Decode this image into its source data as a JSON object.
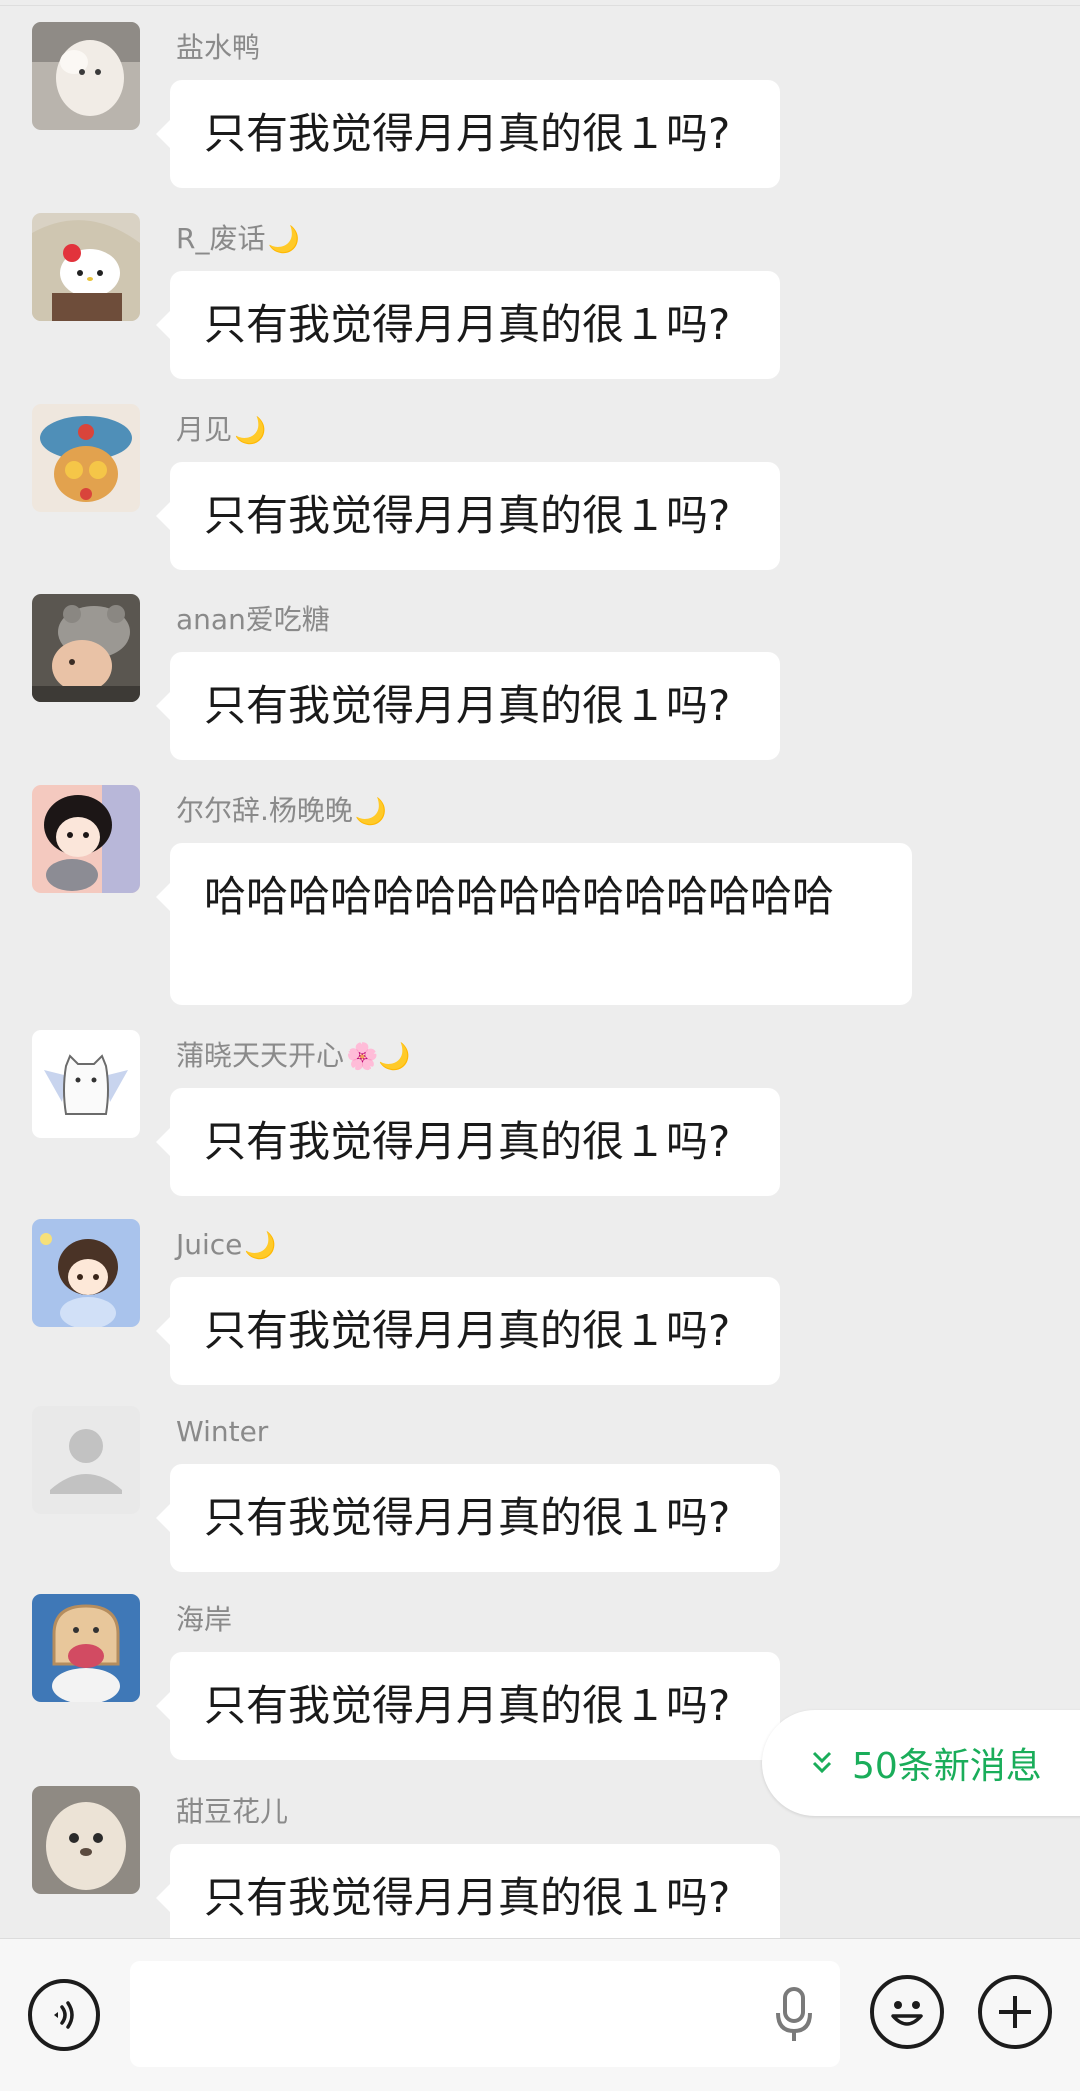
{
  "messages": [
    {
      "sender": "盐水鸭",
      "emoji": "",
      "text": "只有我觉得月月真的很１吗?",
      "avatar": "white-dog-avatar"
    },
    {
      "sender": "R_废话",
      "emoji": "🌙",
      "text": "只有我觉得月月真的很１吗?",
      "avatar": "hello-kitty-avatar"
    },
    {
      "sender": "月见",
      "emoji": "🌙",
      "text": "只有我觉得月月真的很１吗?",
      "avatar": "bear-hat-avatar"
    },
    {
      "sender": "anan爱吃糖",
      "emoji": "",
      "text": "只有我觉得月月真的很１吗?",
      "avatar": "baby-avatar"
    },
    {
      "sender": "尔尔辞.杨晚晚",
      "emoji": "🌙",
      "text": "哈哈哈哈哈哈哈哈哈哈哈哈哈哈哈",
      "avatar": "anime-girl-avatar"
    },
    {
      "sender": "蒲晓天天开心",
      "emoji": "🌸🌙",
      "text": "只有我觉得月月真的很１吗?",
      "avatar": "ghost-cat-avatar"
    },
    {
      "sender": "Juice",
      "emoji": "🌙",
      "text": "只有我觉得月月真的很１吗?",
      "avatar": "anime-chibi-avatar"
    },
    {
      "sender": "Winter",
      "emoji": "",
      "text": "只有我觉得月月真的很１吗?",
      "avatar": "default-person-avatar"
    },
    {
      "sender": "海岸",
      "emoji": "",
      "text": "只有我觉得月月真的很１吗?",
      "avatar": "toast-plush-avatar"
    },
    {
      "sender": "甜豆花儿",
      "emoji": "",
      "text": "只有我觉得月月真的很１吗?",
      "avatar": "seal-avatar"
    }
  ],
  "new_messages": {
    "label": "50条新消息"
  },
  "input": {
    "placeholder": ""
  },
  "icons": {
    "voice": "voice-icon",
    "mic": "microphone-icon",
    "emoji": "emoji-icon",
    "plus": "plus-icon",
    "chevron": "double-chevron-down-icon"
  },
  "colors": {
    "background": "#ededed",
    "bubble": "#ffffff",
    "accent": "#1aad5a",
    "sender_text": "#8a8a8a"
  }
}
